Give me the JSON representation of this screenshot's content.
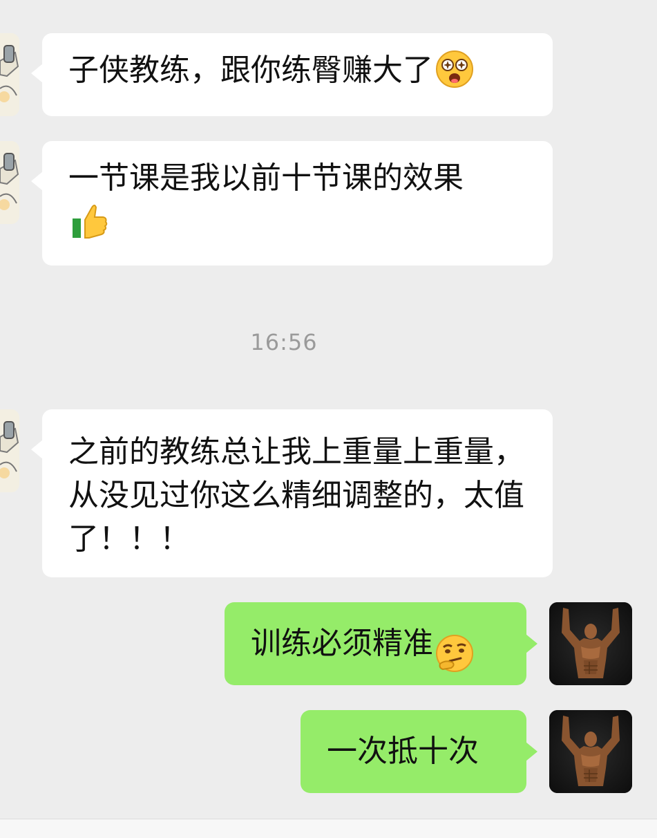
{
  "messages": [
    {
      "side": "in",
      "text": "子侠教练，跟你练臀赚大了",
      "emoji": "star-struck-face"
    },
    {
      "side": "in",
      "text": "一节课是我以前十节课的效果",
      "emoji": "thumbs-up"
    },
    {
      "side": "in",
      "text": "之前的教练总让我上重量上重量，从没见过你这么精细调整的，太值了！！！"
    },
    {
      "side": "out",
      "text": "训练必须精准",
      "emoji": "thinking-face"
    },
    {
      "side": "out",
      "text": "一次抵十次"
    }
  ],
  "timestamp": "16:56",
  "colors": {
    "background": "#ededed",
    "incoming_bubble": "#ffffff",
    "outgoing_bubble": "#95ec69",
    "timestamp_text": "#9a9a9a"
  }
}
